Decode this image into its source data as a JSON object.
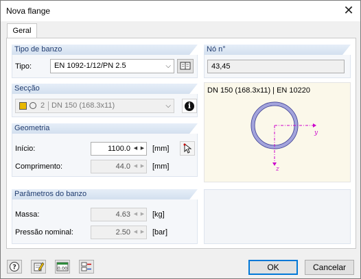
{
  "window": {
    "title": "Nova flange",
    "close_glyph": "✕"
  },
  "tabs": [
    {
      "label": "Geral"
    }
  ],
  "tipo_de_banzo": {
    "header": "Tipo de banzo",
    "tipo_label": "Tipo:",
    "tipo_value": "EN 1092-1/12/PN 2.5",
    "library_icon": "library-book-icon"
  },
  "no": {
    "header": "Nó n°",
    "value": "43,45"
  },
  "seccao": {
    "header": "Secção",
    "number": "2",
    "value": "DN 150 (168.3x11)",
    "color_swatch": "#e8b800",
    "info_glyph": "i"
  },
  "geometria": {
    "header": "Geometria",
    "inicio_label": "Início:",
    "inicio_value": "1100.0",
    "inicio_unit": "[mm]",
    "comprimento_label": "Comprimento:",
    "comprimento_value": "44.0",
    "comprimento_unit": "[mm]",
    "pick_icon": "pick-cursor-icon"
  },
  "parametros": {
    "header": "Parâmetros do banzo",
    "massa_label": "Massa:",
    "massa_value": "4.63",
    "massa_unit": "[kg]",
    "pressao_label": "Pressão nominal:",
    "pressao_value": "2.50",
    "pressao_unit": "[bar]"
  },
  "preview": {
    "title": "DN 150 (168.3x11) | EN 10220",
    "y_axis_label": "y",
    "z_axis_label": "z",
    "ring_color": "#8d8fd8",
    "axis_color": "#cc00cc"
  },
  "footer": {
    "ok_label": "OK",
    "cancel_label": "Cancelar",
    "icons": [
      "help-icon",
      "edit-icon",
      "units-icon",
      "settings-icon"
    ]
  }
}
